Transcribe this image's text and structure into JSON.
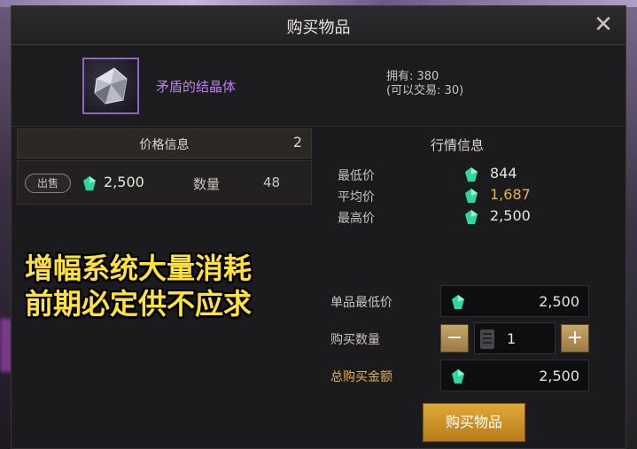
{
  "window": {
    "title": "购买物品",
    "close_label": "✕"
  },
  "item": {
    "name": "矛盾的结晶体",
    "owned_line": "拥有: 380",
    "tradable_line": "(可以交易: 30)"
  },
  "price_info": {
    "header": "价格信息",
    "count": "2",
    "rows": [
      {
        "badge": "出售",
        "price": "2,500",
        "qty_label": "数量",
        "qty": "48"
      }
    ]
  },
  "market_info": {
    "title": "行情信息",
    "rows": [
      {
        "label": "最低价",
        "value": "844",
        "color": "#e8e4dc"
      },
      {
        "label": "平均价",
        "value": "1,687",
        "color": "#e0b24a"
      },
      {
        "label": "最高价",
        "value": "2,500",
        "color": "#e8e4dc"
      }
    ]
  },
  "form": {
    "unit_price_label": "单品最低价",
    "unit_price": "2,500",
    "qty_label": "购买数量",
    "qty": "1",
    "minus": "−",
    "plus": "+",
    "total_label": "总购买金额",
    "total": "2,500"
  },
  "buy_button": "购买物品",
  "caption": {
    "line1": "增幅系统大量消耗",
    "line2": "前期必定供不应求"
  },
  "colors": {
    "gem": "#2fd6a0",
    "accent_gold": "#e0b24a",
    "item_purple": "#b684e6"
  },
  "icons": {
    "gem": "gem-icon",
    "calculator": "calculator-icon",
    "close": "close-icon"
  }
}
